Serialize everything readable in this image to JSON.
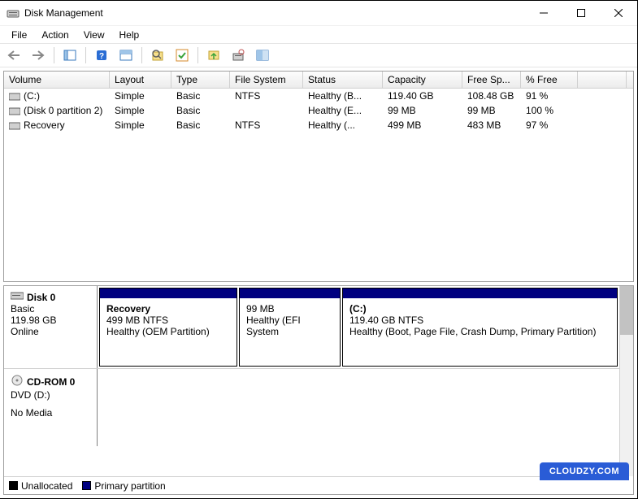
{
  "window": {
    "title": "Disk Management"
  },
  "menu": {
    "file": "File",
    "action": "Action",
    "view": "View",
    "help": "Help"
  },
  "columns": {
    "volume": "Volume",
    "layout": "Layout",
    "type": "Type",
    "fs": "File System",
    "status": "Status",
    "capacity": "Capacity",
    "free": "Free Sp...",
    "pct": "% Free"
  },
  "volumes": [
    {
      "name": "(C:)",
      "layout": "Simple",
      "type": "Basic",
      "fs": "NTFS",
      "status": "Healthy (B...",
      "capacity": "119.40 GB",
      "free": "108.48 GB",
      "pct": "91 %"
    },
    {
      "name": "(Disk 0 partition 2)",
      "layout": "Simple",
      "type": "Basic",
      "fs": "",
      "status": "Healthy (E...",
      "capacity": "99 MB",
      "free": "99 MB",
      "pct": "100 %"
    },
    {
      "name": "Recovery",
      "layout": "Simple",
      "type": "Basic",
      "fs": "NTFS",
      "status": "Healthy (...",
      "capacity": "499 MB",
      "free": "483 MB",
      "pct": "97 %"
    }
  ],
  "disks": {
    "disk0": {
      "title": "Disk 0",
      "type": "Basic",
      "size": "119.98 GB",
      "status": "Online",
      "p0": {
        "title": "Recovery",
        "line1": "499 MB NTFS",
        "line2": "Healthy (OEM Partition)"
      },
      "p1": {
        "title": "",
        "line1": "99 MB",
        "line2": "Healthy (EFI System"
      },
      "p2": {
        "title": "(C:)",
        "line1": "119.40 GB NTFS",
        "line2": "Healthy (Boot, Page File, Crash Dump, Primary Partition)"
      }
    },
    "cdrom0": {
      "title": "CD-ROM 0",
      "line1": "DVD (D:)",
      "line2": "No Media"
    }
  },
  "legend": {
    "unallocated": "Unallocated",
    "primary": "Primary partition"
  },
  "watermark": "CLOUDZY.COM"
}
